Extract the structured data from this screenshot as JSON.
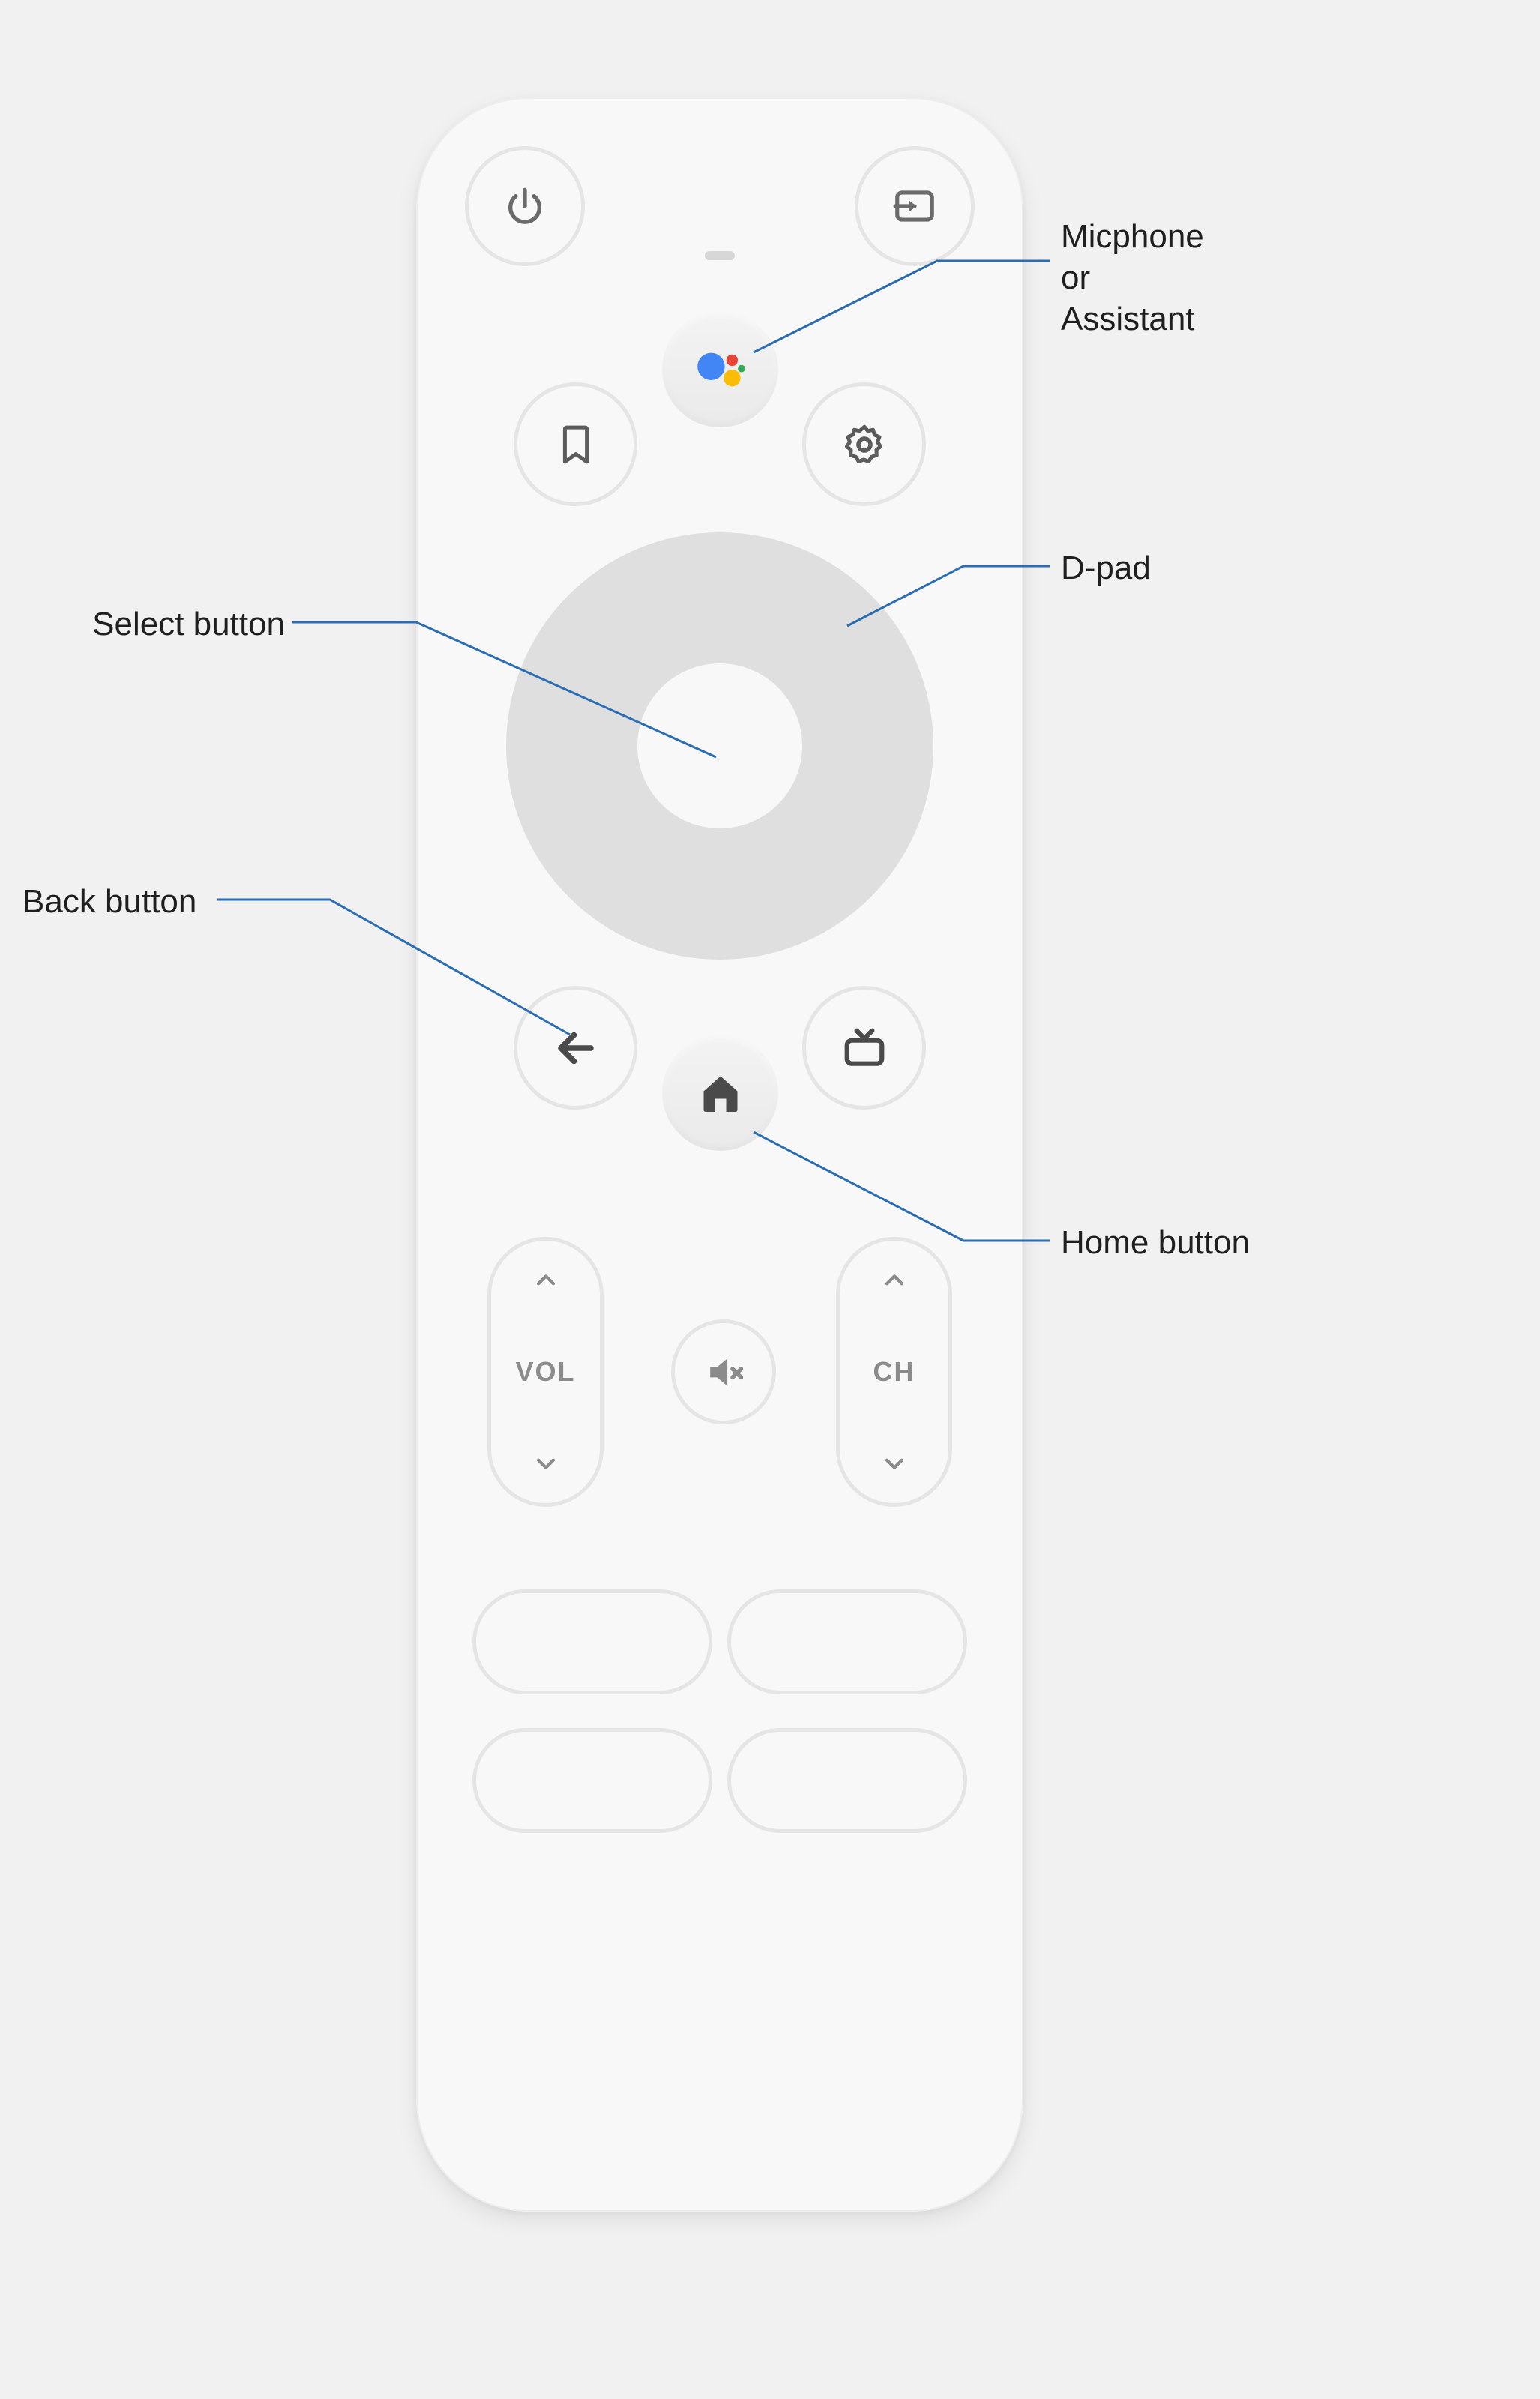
{
  "annotations": {
    "assistant": "Micphone\nor\nAssistant",
    "dpad": "D-pad",
    "select": "Select button",
    "back": "Back button",
    "home": "Home button"
  },
  "rockers": {
    "volume": "VOL",
    "channel": "CH"
  },
  "icons": {
    "power": "power-icon",
    "input": "input-icon",
    "assistant": "assistant-icon",
    "bookmark": "bookmark-icon",
    "settings": "settings-icon",
    "back": "back-arrow-icon",
    "home": "home-icon",
    "tv": "tv-icon",
    "mute": "mute-icon",
    "chev_up": "chevron-up-icon",
    "chev_down": "chevron-down-icon"
  },
  "colors": {
    "google_blue": "#4285F4",
    "google_red": "#EA4335",
    "google_yellow": "#FBBC05",
    "google_green": "#34A853"
  }
}
